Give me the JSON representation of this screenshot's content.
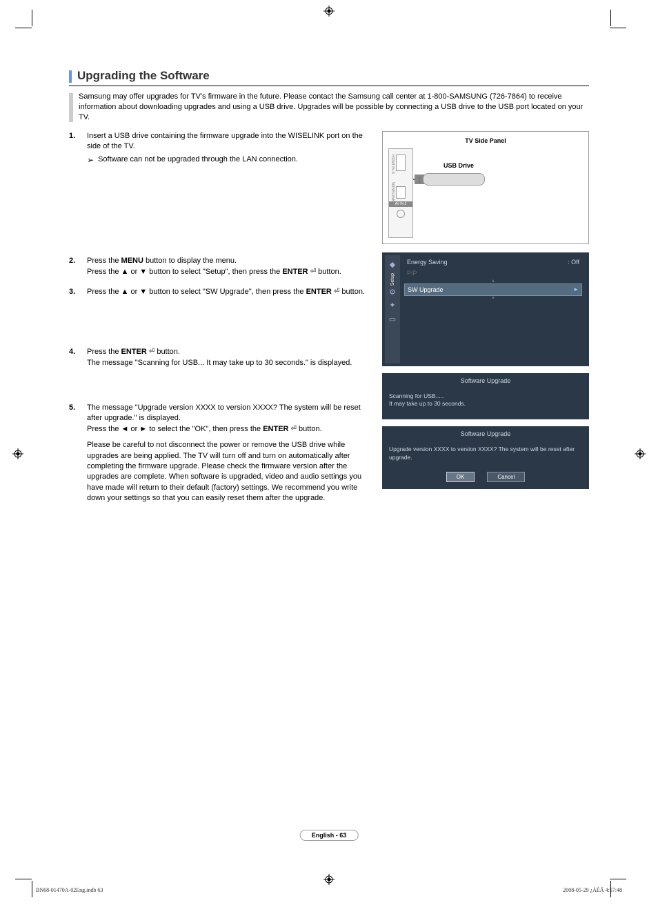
{
  "title": "Upgrading the Software",
  "intro": "Samsung may offer upgrades for TV's firmware in the future. Please contact the Samsung call center at 1-800-SAMSUNG (726-7864) to receive information about downloading upgrades and using a USB drive. Upgrades will be possible by connecting a USB drive to the USB port located on your TV.",
  "steps": [
    {
      "num": "1.",
      "text": "Insert a USB drive containing the firmware upgrade into the WISELINK port on the side of the TV.",
      "note": "Software can not be upgraded through the LAN connection."
    },
    {
      "num": "2.",
      "pre": "Press the ",
      "bold1": "MENU",
      "mid1": " button to display the menu.",
      "line2a": "Press the ▲ or ▼ button to select \"Setup\", then press the ",
      "bold2": "ENTER",
      "line2b": " button."
    },
    {
      "num": "3.",
      "line1a": "Press the ▲ or ▼ button to select \"SW Upgrade\", then press the ",
      "bold1": "ENTER",
      "line1b": " button."
    },
    {
      "num": "4.",
      "pre": "Press the ",
      "bold1": "ENTER",
      "mid1": "  button.",
      "line2": "The message \"Scanning for USB... It may take up to 30 seconds.\" is displayed."
    },
    {
      "num": "5.",
      "line1": "The message \"Upgrade version XXXX to version XXXX? The system will be reset after upgrade.\" is displayed.",
      "line2a": "Press the ◄ or ► to select the \"OK\", then press the ",
      "bold2": "ENTER",
      "line2b": " button."
    }
  ],
  "caution": "Please be careful to not disconnect the power or remove the USB drive while upgrades are being applied. The TV will turn off and turn on automatically after completing the firmware upgrade. Please check the firmware version after the upgrades are complete. When software is upgraded, video and audio settings you have made will return to their default (factory) settings. We recommend you write down your settings so that you can easily reset them after the upgrade.",
  "panel": {
    "title": "TV Side Panel",
    "usb_label": "USB Drive",
    "av_label": "AV IN 2",
    "wiselink": "WISELINK"
  },
  "menu": {
    "sidebar_label": "Setup",
    "row1_label": "Energy Saving",
    "row1_val": ": Off",
    "row2_label": "PIP",
    "row3_label": "SW Upgrade"
  },
  "dialog1": {
    "title": "Software Upgrade",
    "line1": "Scanning for USB.....",
    "line2": "It may take up to 30 seconds."
  },
  "dialog2": {
    "title": "Software Upgrade",
    "body": "Upgrade version XXXX to version XXXX? The system will be reset after upgrade.",
    "ok": "OK",
    "cancel": "Cancel"
  },
  "footer": {
    "page": "English - 63",
    "left": "BN68-01470A-02Eng.indb   63",
    "right": "2008-05-29   ¿ÀÈÄ 4:57:48"
  }
}
